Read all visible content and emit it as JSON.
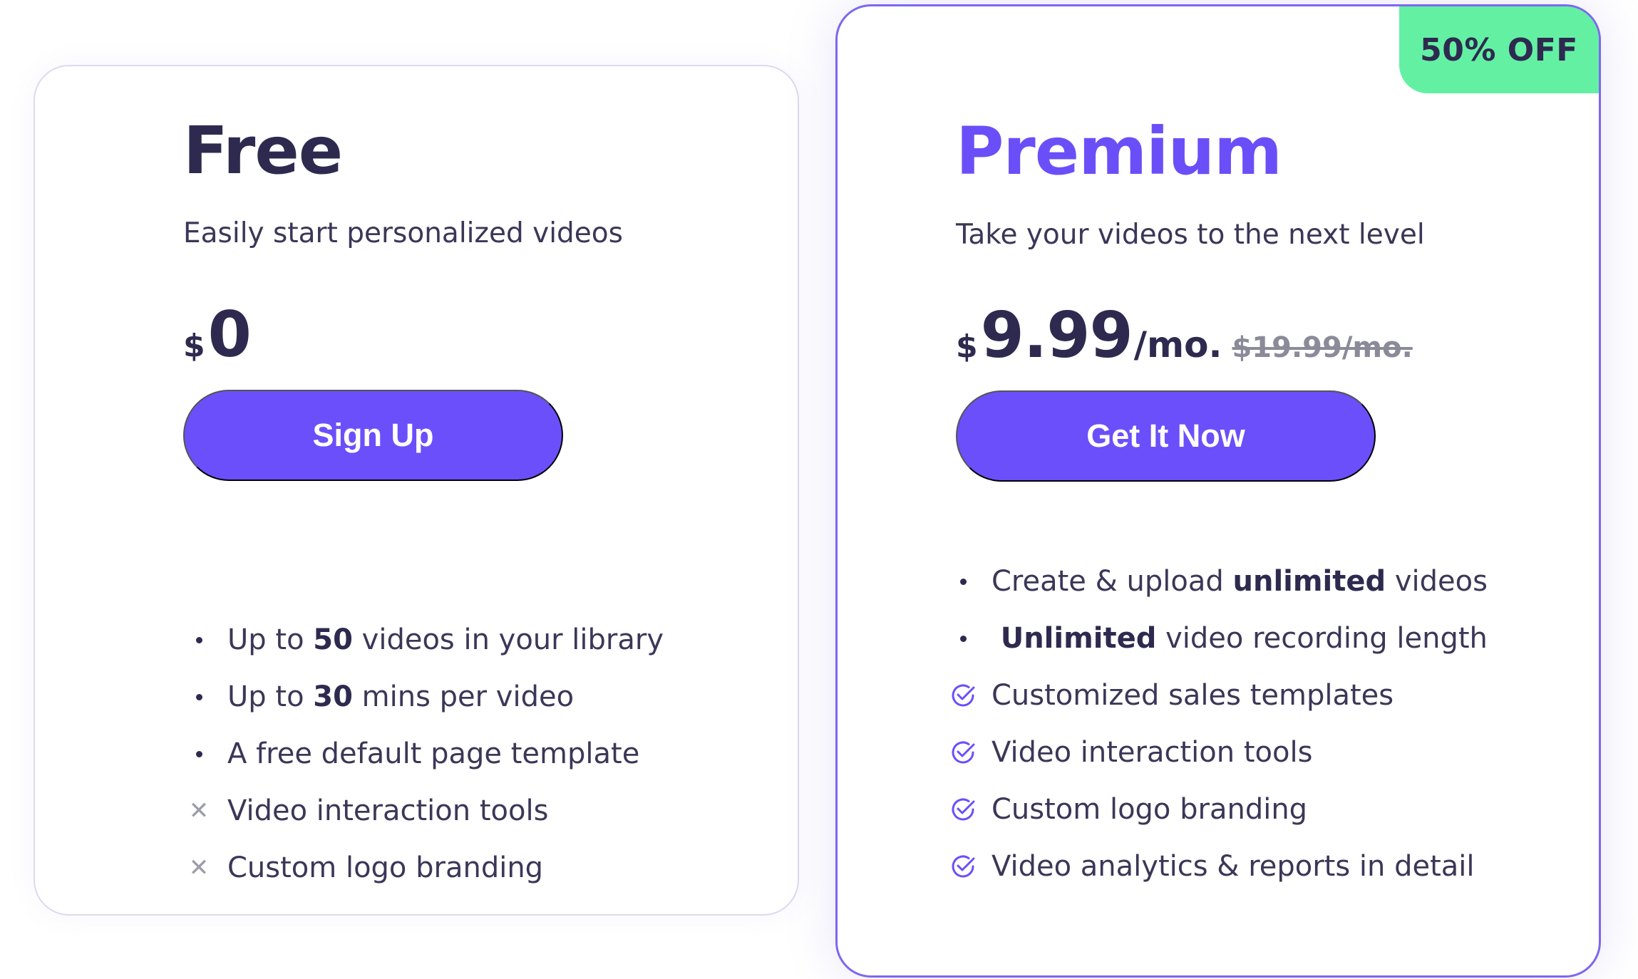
{
  "free": {
    "name": "Free",
    "tagline": "Easily start personalized videos",
    "currency": "$",
    "amount": "0",
    "cta_label": "Sign Up",
    "features": [
      {
        "icon": "bullet",
        "prefix": "Up to ",
        "bold": "50",
        "suffix": " videos in your library"
      },
      {
        "icon": "bullet",
        "prefix": "Up to ",
        "bold": "30",
        "suffix": " mins per video"
      },
      {
        "icon": "bullet",
        "prefix": "A free default page template",
        "bold": "",
        "suffix": ""
      },
      {
        "icon": "cross-icon",
        "prefix": "Video interaction tools",
        "bold": "",
        "suffix": ""
      },
      {
        "icon": "cross-icon",
        "prefix": "Custom logo branding",
        "bold": "",
        "suffix": ""
      }
    ]
  },
  "premium": {
    "badge": "50% OFF",
    "name": "Premium",
    "tagline": "Take your videos to the next level",
    "currency": "$",
    "amount": "9.99",
    "period": "/mo.",
    "old_price": "$19.99/mo.",
    "cta_label": "Get It Now",
    "features": [
      {
        "icon": "bullet",
        "prefix": "Create & upload ",
        "bold": "unlimited",
        "suffix": " videos"
      },
      {
        "icon": "bullet",
        "prefix": " ",
        "bold": "Unlimited",
        "suffix": " video recording length"
      },
      {
        "icon": "check-icon",
        "prefix": "Customized sales templates",
        "bold": "",
        "suffix": ""
      },
      {
        "icon": "check-icon",
        "prefix": "Video interaction tools",
        "bold": "",
        "suffix": ""
      },
      {
        "icon": "check-icon",
        "prefix": "Custom logo branding",
        "bold": "",
        "suffix": ""
      },
      {
        "icon": "check-icon",
        "prefix": "Video analytics & reports in detail",
        "bold": "",
        "suffix": ""
      }
    ]
  },
  "colors": {
    "accent": "#6b4ffb",
    "premium_title": "#6a4ff8",
    "badge_bg": "#63f0a3",
    "text_dark": "#2e2a4f",
    "muted": "#8a8a99"
  }
}
